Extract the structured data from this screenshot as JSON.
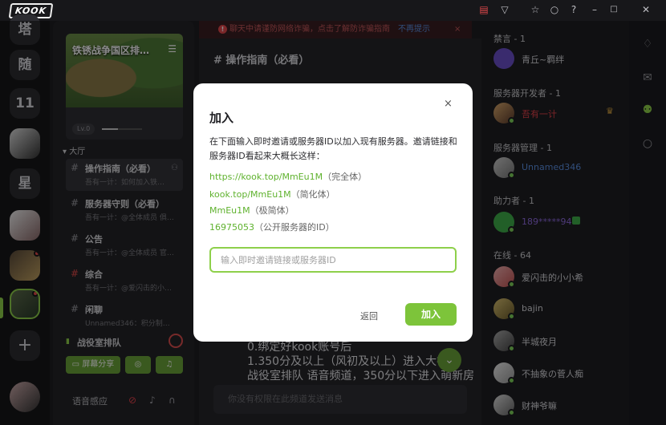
{
  "titlebar": {
    "logo": "KOOK",
    "icons": [
      "gift-icon",
      "shirt-icon",
      "star-icon",
      "search-icon",
      "minimize-icon",
      "maximize-icon",
      "close-icon"
    ]
  },
  "notice": {
    "text": "聊天中请谨防网络诈骗，点击了解防诈骗指南",
    "link": "不再提示",
    "close": "×"
  },
  "rail": {
    "items": [
      {
        "label": "塔",
        "kind": "text"
      },
      {
        "label": "随",
        "kind": "text"
      },
      {
        "label": "11",
        "kind": "text"
      },
      {
        "label": "",
        "kind": "image"
      },
      {
        "label": "星",
        "kind": "text"
      },
      {
        "label": "",
        "kind": "image"
      },
      {
        "label": "",
        "kind": "image"
      },
      {
        "label": "",
        "kind": "image"
      }
    ],
    "add": "+"
  },
  "server": {
    "title": "铁锈战争国区排…",
    "level": "Lv.0",
    "category": "▾ 大厅",
    "channels": [
      {
        "name": "操作指南（必看）",
        "sub": "吾有一计：如何加入铁…"
      },
      {
        "name": "服务器守则（必看）",
        "sub": "吾有一计：@全体成员 俱…"
      },
      {
        "name": "公告",
        "sub": "吾有一计：@全体成员 官…"
      },
      {
        "name": "综合",
        "sub": "吾有一计：@爱闪击的小…"
      },
      {
        "name": "闲聊",
        "sub": "Unnamed346：积分制…"
      }
    ],
    "voice_channel": "战役室排队",
    "voice_buttons": [
      "屏幕分享"
    ],
    "voice_status": "语音感应"
  },
  "main": {
    "channel_title": "# 操作指南（必看）",
    "lines": [
      "0.绑定好kook账号后",
      "1.350分及以上（风初及以上）进入大神房",
      "战役室排队 语音频道，350分以下进入萌新房"
    ],
    "input_placeholder": "你没有权限在此频道发送消息"
  },
  "members": {
    "groups": [
      {
        "title": "禁言 - 1",
        "members": [
          {
            "name": "青丘~羁绊",
            "color": "#d6d6da"
          }
        ]
      },
      {
        "title": "服务器开发者 - 1",
        "members": [
          {
            "name": "吾有一计",
            "color": "#e0414a"
          }
        ]
      },
      {
        "title": "服务器管理 - 1",
        "members": [
          {
            "name": "Unnamed346",
            "color": "#5a8ee0"
          }
        ]
      },
      {
        "title": "助力者 - 1",
        "members": [
          {
            "name": "189*****940",
            "color": "#8f6adf"
          }
        ]
      },
      {
        "title": "在线 - 64",
        "members": [
          {
            "name": "爱闪击的小小希",
            "color": "#d6d6da"
          },
          {
            "name": "bajin",
            "color": "#d6d6da"
          },
          {
            "name": "半城夜月",
            "color": "#d6d6da"
          },
          {
            "name": "不抽象の菅人痴",
            "color": "#d6d6da"
          },
          {
            "name": "财神爷嘛",
            "color": "#d6d6da"
          }
        ]
      }
    ]
  },
  "dialog": {
    "title": "加入",
    "close": "×",
    "description": "在下面输入即时邀请或服务器ID以加入现有服务器。邀请链接和服务器ID看起来大概长这样：",
    "examples": [
      {
        "value": "https://kook.top/MmEu1M",
        "hint": "（完全体）"
      },
      {
        "value": "kook.top/MmEu1M",
        "hint": "（简化体）"
      },
      {
        "value": "MmEu1M",
        "hint": "（极简体）"
      },
      {
        "value": "16975053",
        "hint": "（公开服务器的ID）"
      }
    ],
    "input_placeholder": "输入即时邀请链接或服务器ID",
    "back_label": "返回",
    "join_label": "加入"
  },
  "colors": {
    "accent": "#7dc43a",
    "danger": "#e0414a",
    "link": "#5a8ee0"
  }
}
